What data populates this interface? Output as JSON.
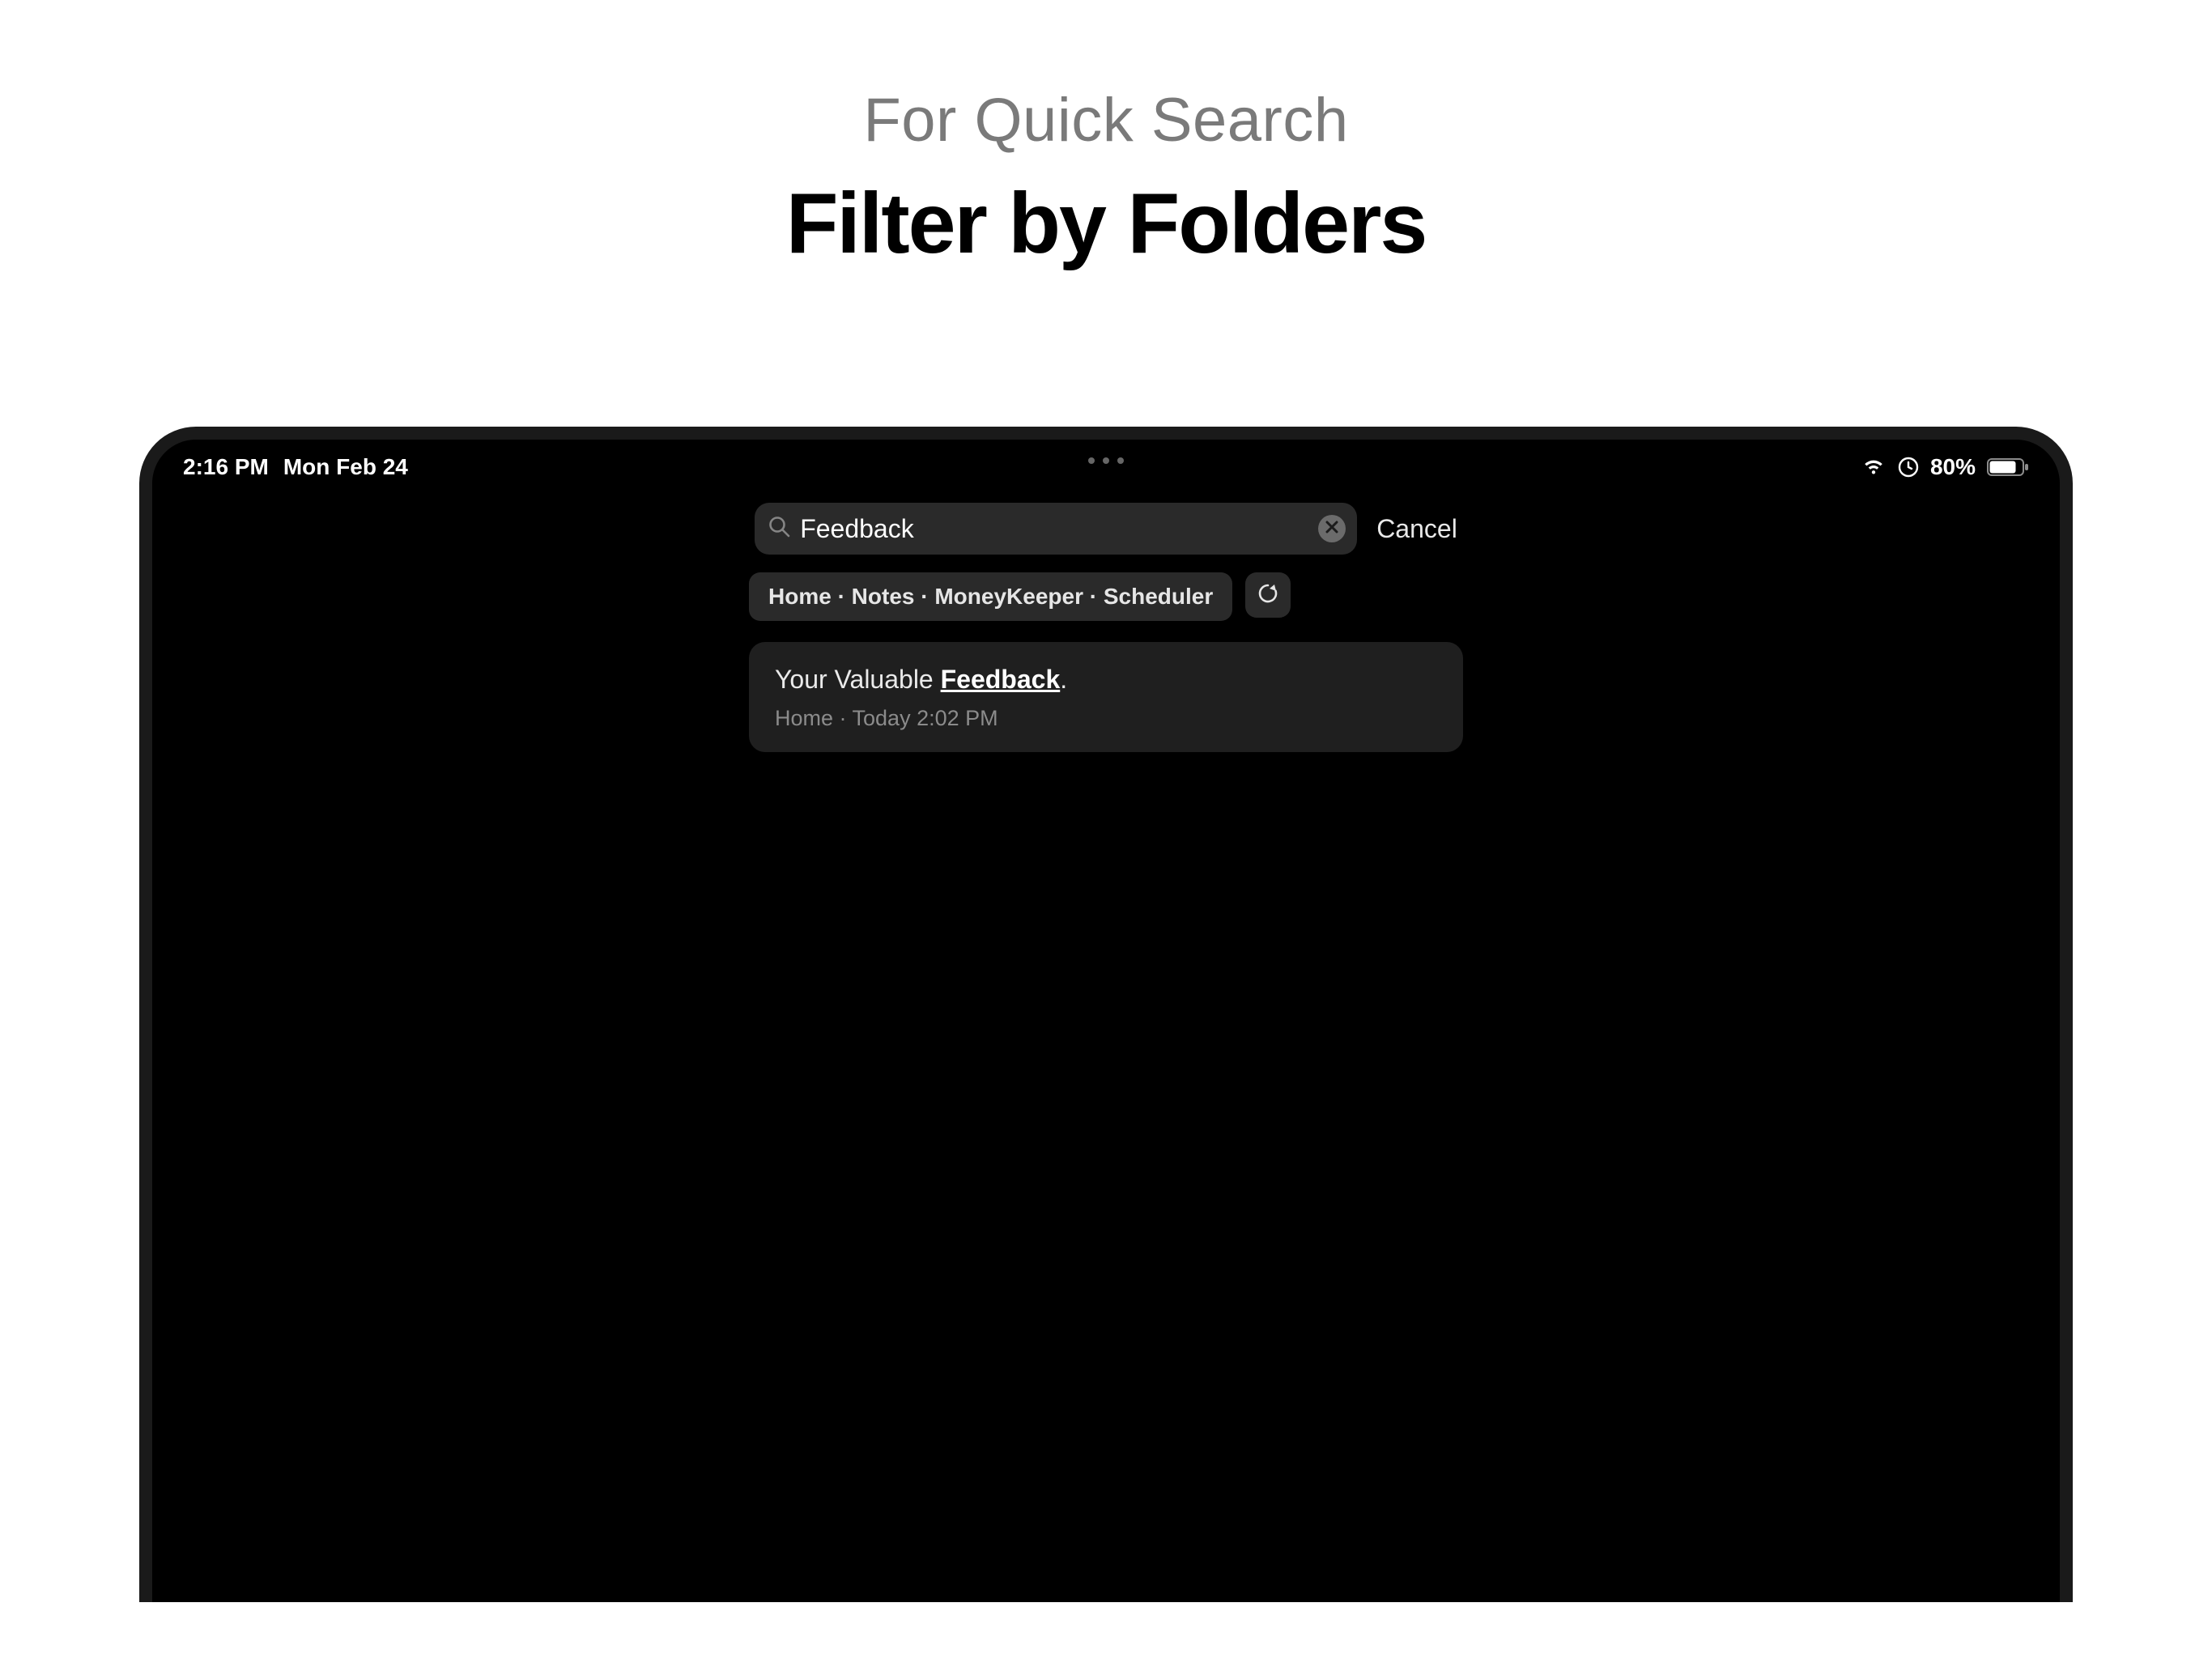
{
  "headline": {
    "sub": "For Quick Search",
    "main": "Filter by Folders"
  },
  "status": {
    "time": "2:16 PM",
    "date": "Mon Feb 24",
    "battery_pct": "80%"
  },
  "search": {
    "value": "Feedback",
    "cancel_label": "Cancel"
  },
  "filter": {
    "chip_text": "Home · Notes · MoneyKeeper · Scheduler"
  },
  "results": {
    "0": {
      "title_prefix": "Your Valuable ",
      "title_match": "Feedback",
      "title_suffix": ".",
      "meta": "Home ·  Today 2:02 PM"
    }
  }
}
